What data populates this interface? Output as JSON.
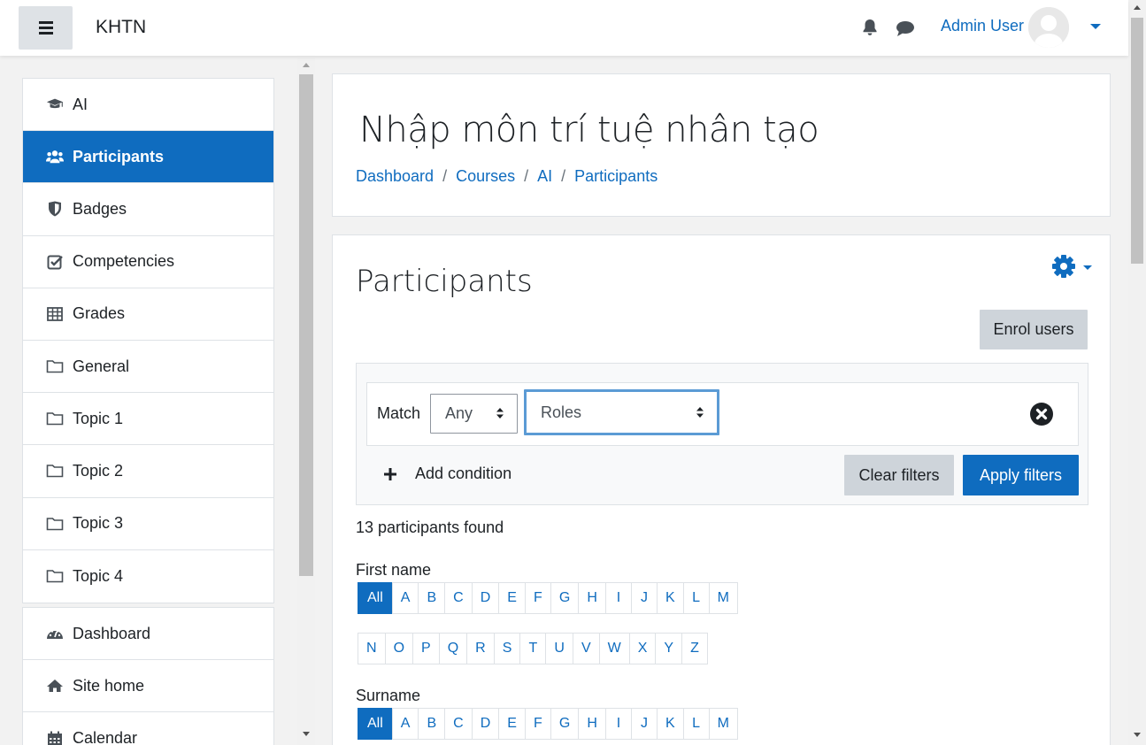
{
  "navbar": {
    "site_name": "KHTN",
    "user_name": "Admin User"
  },
  "drawer": {
    "course_items": [
      {
        "label": "AI",
        "icon": "graduation-cap-icon"
      },
      {
        "label": "Participants",
        "icon": "users-icon",
        "active": true
      },
      {
        "label": "Badges",
        "icon": "shield-icon"
      },
      {
        "label": "Competencies",
        "icon": "check-square-icon"
      },
      {
        "label": "Grades",
        "icon": "table-icon"
      },
      {
        "label": "General",
        "icon": "folder-icon"
      },
      {
        "label": "Topic 1",
        "icon": "folder-icon"
      },
      {
        "label": "Topic 2",
        "icon": "folder-icon"
      },
      {
        "label": "Topic 3",
        "icon": "folder-icon"
      },
      {
        "label": "Topic 4",
        "icon": "folder-icon"
      }
    ],
    "site_items": [
      {
        "label": "Dashboard",
        "icon": "tachometer-icon"
      },
      {
        "label": "Site home",
        "icon": "home-icon"
      },
      {
        "label": "Calendar",
        "icon": "calendar-icon"
      }
    ]
  },
  "header": {
    "course_title": "Nhập môn trí tuệ nhân tạo",
    "breadcrumb": [
      "Dashboard",
      "Courses",
      "AI",
      "Participants"
    ],
    "breadcrumb_sep": "/"
  },
  "participants": {
    "heading": "Participants",
    "enrol_button": "Enrol users",
    "filter": {
      "match_label": "Match",
      "match_value": "Any",
      "condition_value": "Roles",
      "add_condition": "Add condition",
      "clear_button": "Clear filters",
      "apply_button": "Apply filters"
    },
    "found_text": "13 participants found",
    "first_name_label": "First name",
    "surname_label": "Surname",
    "all_label": "All",
    "letters_row1": [
      "A",
      "B",
      "C",
      "D",
      "E",
      "F",
      "G",
      "H",
      "I",
      "J",
      "K",
      "L",
      "M"
    ],
    "letters_row2": [
      "N",
      "O",
      "P",
      "Q",
      "R",
      "S",
      "T",
      "U",
      "V",
      "W",
      "X",
      "Y",
      "Z"
    ]
  },
  "colors": {
    "primary": "#0f6cbf",
    "secondary_btn": "#ced4da",
    "text": "#1d2125"
  }
}
